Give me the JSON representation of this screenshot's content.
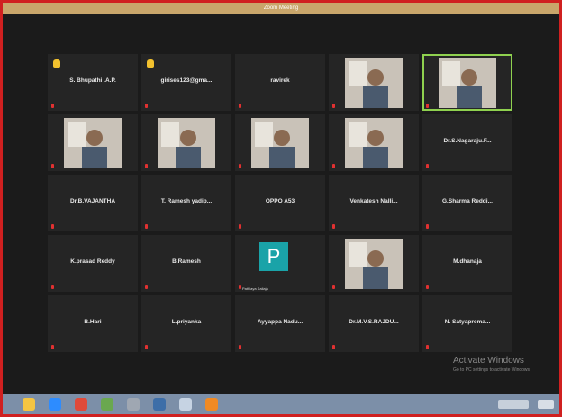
{
  "window": {
    "title": "Zoom Meeting"
  },
  "participants": [
    {
      "name": "S. Bhupathi .A.P.",
      "hand_raised": true
    },
    {
      "name": "girises123@gma...",
      "hand_raised": true
    },
    {
      "name": "ravirek"
    },
    {
      "name": "",
      "video": true,
      "caption": ""
    },
    {
      "name": "",
      "video": true,
      "caption": "",
      "active": true
    },
    {
      "name": "",
      "video": true,
      "caption": ""
    },
    {
      "name": "",
      "video": true,
      "caption": ""
    },
    {
      "name": "",
      "video": true,
      "caption": ""
    },
    {
      "name": "",
      "video": true,
      "caption": ""
    },
    {
      "name": "Dr.S.Nagaraju.F..."
    },
    {
      "name": "Dr.B.VAJANTHA"
    },
    {
      "name": "T. Ramesh yadip..."
    },
    {
      "name": "OPPO A53"
    },
    {
      "name": "Venkatesh  Nalli..."
    },
    {
      "name": "G.Sharma  Reddi..."
    },
    {
      "name": "K.prasad Reddy"
    },
    {
      "name": "B.Ramesh"
    },
    {
      "name": "",
      "avatar_letter": "P",
      "caption": "Pathlaya Sailaja"
    },
    {
      "name": "",
      "video": true,
      "caption": ""
    },
    {
      "name": "M.dhanaja"
    },
    {
      "name": "B.Hari"
    },
    {
      "name": "L.priyanka"
    },
    {
      "name": "Ayyappa  Nadu..."
    },
    {
      "name": "Dr.M.V.S.RAJDU..."
    },
    {
      "name": "N. Satyaprema..."
    }
  ],
  "watermark": {
    "line1": "Activate Windows",
    "line2": "Go to PC settings to activate Windows."
  },
  "colors": {
    "frame_border": "#d02020",
    "title_bar": "#c9a66b",
    "avatar_p": "#1aa3a8",
    "active_speaker": "#8fd14f",
    "mic_muted": "#e03131",
    "hand": "#f2c12e"
  },
  "taskbar_icons": [
    {
      "icon": "file-explorer-icon",
      "color": "#f5c542"
    },
    {
      "icon": "zoom-icon",
      "color": "#2d8cff"
    },
    {
      "icon": "chrome-icon",
      "color": "#e04a3a"
    },
    {
      "icon": "app-icon",
      "color": "#6aa84f"
    },
    {
      "icon": "app-icon",
      "color": "#9fa7b2"
    },
    {
      "icon": "app-icon",
      "color": "#3d6ea8"
    },
    {
      "icon": "document-icon",
      "color": "#c6d3e3"
    },
    {
      "icon": "vlc-icon",
      "color": "#f08a24"
    }
  ]
}
